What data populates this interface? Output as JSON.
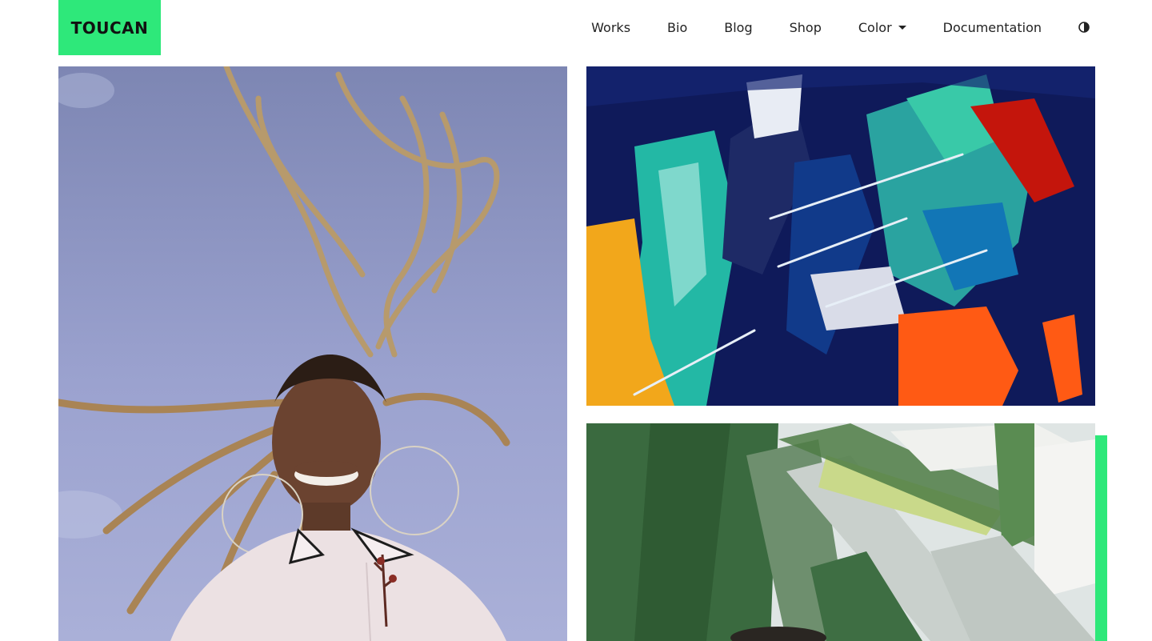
{
  "brand": {
    "name": "TOUCAN",
    "accent_color": "#2ee87a"
  },
  "nav": {
    "items": [
      {
        "label": "Works"
      },
      {
        "label": "Bio"
      },
      {
        "label": "Blog"
      },
      {
        "label": "Shop"
      },
      {
        "label": "Color",
        "has_dropdown": true
      },
      {
        "label": "Documentation"
      }
    ],
    "theme_toggle_icon": "contrast-icon"
  },
  "gallery": {
    "items": [
      {
        "name": "portrait-photo",
        "subject": "smiling woman with braids against sky"
      },
      {
        "name": "abstract-painting",
        "subject": "abstract acrylic paint strokes"
      },
      {
        "name": "plant-painting",
        "subject": "green leaves painting"
      }
    ]
  }
}
